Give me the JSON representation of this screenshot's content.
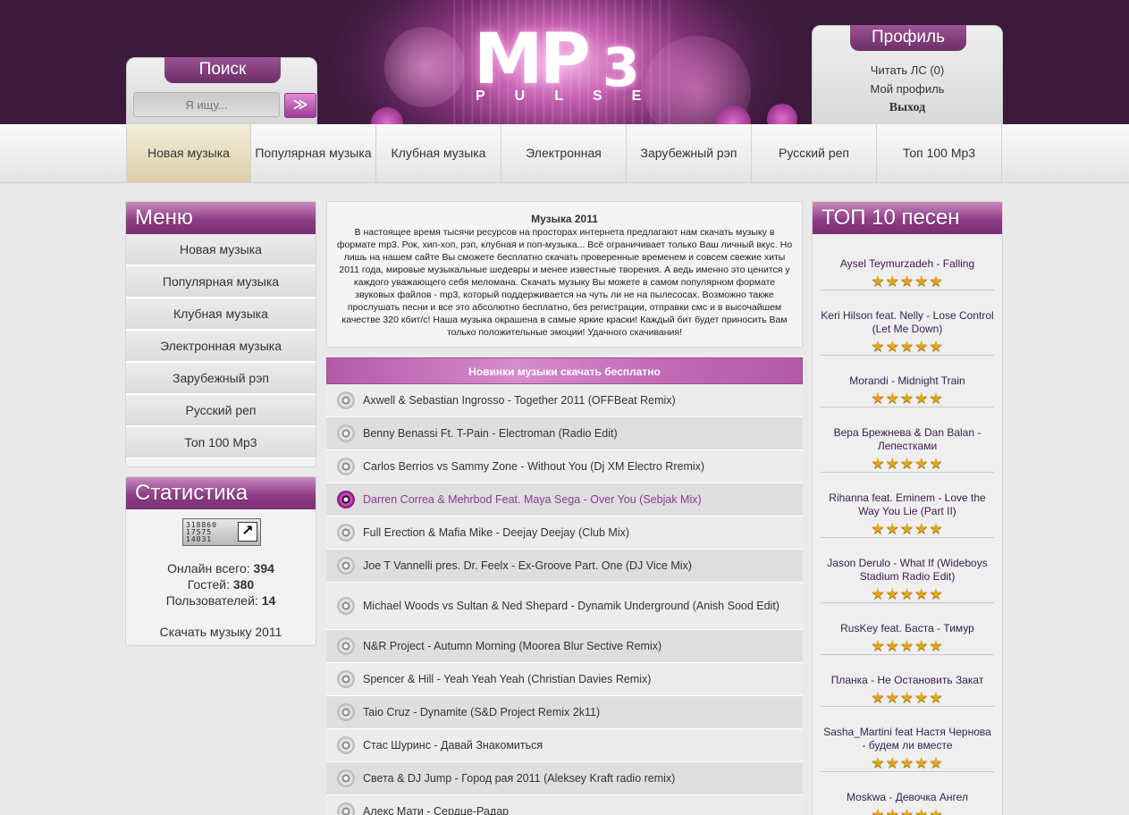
{
  "logo": {
    "mp": "MP",
    "three": "3",
    "pulse": "PULSE"
  },
  "search": {
    "title": "Поиск",
    "placeholder": "Я ищу...",
    "button": "≫"
  },
  "profile": {
    "title": "Профиль",
    "links": [
      "Читать ЛС (0)",
      "Мой профиль",
      "Выход"
    ]
  },
  "nav": [
    "Новая музыка",
    "Популярная музыка",
    "Клубная музыка",
    "Электронная",
    "Зарубежный рэп",
    "Русский реп",
    "Топ 100 Mp3"
  ],
  "menu": {
    "title": "Меню",
    "items": [
      "Новая музыка",
      "Популярная музыка",
      "Клубная музыка",
      "Электронная музыка",
      "Зарубежный рэп",
      "Русский реп",
      "Топ 100 Mp3"
    ]
  },
  "stats": {
    "title": "Статистика",
    "counter": [
      "318860",
      "17575",
      "14031"
    ],
    "online_label": "Онлайн всего:",
    "online": "394",
    "guests_label": "Гостей:",
    "guests": "380",
    "users_label": "Пользователей:",
    "users": "14",
    "download": "Скачать музыку 2011"
  },
  "intro": {
    "title": "Музыка 2011",
    "text": "В настоящее время тысячи ресурсов на просторах интернета предлагают нам скачать музыку в формате mp3. Рок, хип-хоп, рэп, клубная и поп-музыка... Всё ограничивает только Ваш личный вкус. Но лишь на нашем сайте Вы сможете бесплатно скачать проверенные временем и совсем свежие хиты 2011 года, мировые музыкальные шедевры и менее известные творения. А ведь именно это ценится у каждого уважающего себя меломана. Скачать музыку Вы можете в самом популярном формате звуковых файлов - mp3, который поддерживается на чуть ли не на пылесосах. Возможно также прослушать песни и все это абсолютно бесплатно, без регистрации, отправки смс и в высочайшем качестве 320 кбит/с! Наша музыка окрашена в самые яркие краски! Каждый бит будет приносить Вам только положительные эмоции! Удачного скачивания!"
  },
  "new_music": {
    "title": "Новинки музыки скачать бесплатно",
    "tracks": [
      "Axwell & Sebastian Ingrosso - Together 2011 (OFFBeat Remix)",
      "Benny Benassi Ft. T-Pain - Electroman (Radio Edit)",
      "Carlos Berrios vs Sammy Zone - Without You (Dj XM Electro Rremix)",
      "Darren Correa & Mehrbod Feat. Maya Sega - Over You (Sebjak Mix)",
      "Full Erection & Mafia Mike - Deejay Deejay (Club Mix)",
      "Joe T Vannelli pres. Dr. Feelx - Ex-Groove Part. One (DJ Vice Mix)",
      "Michael Woods vs Sultan & Ned Shepard - Dynamik Underground (Anish Sood Edit)",
      "N&R Project - Autumn Morning (Moorea Blur Sective Remix)",
      "Spencer & Hill - Yeah Yeah Yeah (Christian Davies Remix)",
      "Taio Cruz - Dynamite (S&D Project Remix 2k11)",
      "Стас Шуринс - Давай Знакомиться",
      "Света & DJ Jump - Город рая 2011 (Aleksey Kraft radio remix)",
      "Алекс Мати - Сердце-Радар"
    ],
    "playing_index": 3
  },
  "top10": {
    "title": "ТОП 10 песен",
    "rating": 5,
    "items": [
      "Aysel Teymurzadeh - Falling",
      "Keri Hilson feat. Nelly - Lose Control (Let Me Down)",
      "Morandi - Midnight Train",
      "Вера Брежнева & Dan Balan - Лепестками",
      "Rihanna feat. Eminem - Love the Way You Lie (Part II)",
      "Jason Derulo - What If (Wideboys Stadium Radio Edit)",
      "RusKey feat. Баста - Тимур",
      "Планка - Не Остановить Закат",
      "Sasha_Martini feat Настя Чернова - будем ли вместе",
      "Moskwa - Девочка Ангел"
    ]
  },
  "colors": {
    "accent": "#8f3d87",
    "header_dark": "#3b1a3b",
    "star": "#e1a520"
  }
}
